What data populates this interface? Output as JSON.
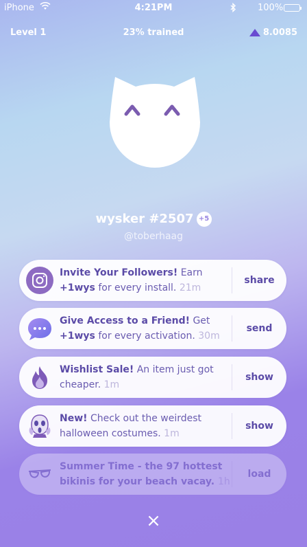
{
  "status_bar": {
    "carrier": "iPhone",
    "time": "4:21PM",
    "battery": "100%"
  },
  "header": {
    "level": "Level 1",
    "trained": "23% trained",
    "balance": "8.0085"
  },
  "profile": {
    "name": "wysker #2507",
    "badge": "+5",
    "handle": "@toberhaag"
  },
  "cards": [
    {
      "title": "Invite Your Followers!",
      "text": " Earn ",
      "bold2": "+1wys",
      "text2": " for every install. ",
      "time": "21m",
      "action": "share",
      "icon": "instagram-icon"
    },
    {
      "title": "Give Access to a Friend!",
      "text": " Get ",
      "bold2": "+1wys",
      "text2": " for every activation. ",
      "time": "30m",
      "action": "send",
      "icon": "message-bubble-icon"
    },
    {
      "title": "Wishlist Sale!",
      "text": " An item just got cheaper. ",
      "time": "1m",
      "action": "show",
      "icon": "fire-icon"
    },
    {
      "title": "New!",
      "text": " Check out the weirdest halloween costumes. ",
      "time": "1m",
      "action": "show",
      "icon": "scream-icon"
    },
    {
      "title": "Summer Time",
      "text": " - the 97 hottest bikinis for your beach vacay. ",
      "time": "1h",
      "action": "load",
      "icon": "sunglasses-icon"
    }
  ],
  "close_label": "×",
  "colors": {
    "accent": "#5b4ba7",
    "timestamp": "#bdb6dc",
    "balance_icon": "#6a4bd1"
  }
}
